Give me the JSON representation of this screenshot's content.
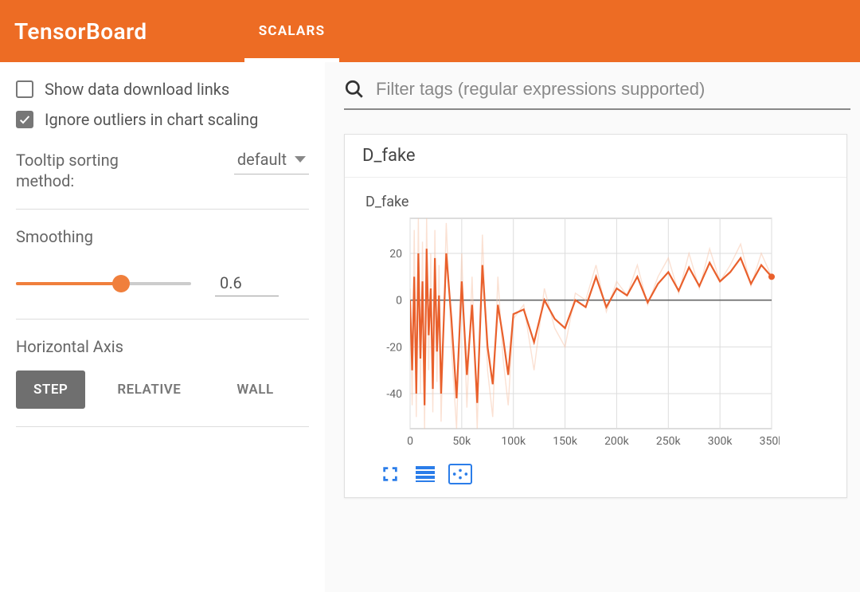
{
  "header": {
    "title": "TensorBoard",
    "tabs": [
      "SCALARS"
    ],
    "active_tab": 0
  },
  "sidebar": {
    "opt_show_download": "Show data download links",
    "opt_ignore_outliers": "Ignore outliers in chart scaling",
    "opt_show_download_checked": false,
    "opt_ignore_outliers_checked": true,
    "tooltip_sort_label": "Tooltip sorting method:",
    "tooltip_sort_value": "default",
    "smoothing_label": "Smoothing",
    "smoothing_value": "0.6",
    "smoothing_fraction": 0.6,
    "horizontal_axis_label": "Horizontal Axis",
    "axis_buttons": [
      "STEP",
      "RELATIVE",
      "WALL"
    ],
    "axis_active": 0
  },
  "main": {
    "search_placeholder": "Filter tags (regular expressions supported)",
    "card_section_title": "D_fake",
    "chart_title": "D_fake"
  },
  "chart_data": {
    "type": "line",
    "title": "D_fake",
    "xlabel": "",
    "ylabel": "",
    "xlim": [
      0,
      350000
    ],
    "ylim": [
      -55,
      35
    ],
    "x_ticks": [
      0,
      50000,
      100000,
      150000,
      200000,
      250000,
      300000,
      350000
    ],
    "x_tick_labels": [
      "0",
      "50k",
      "100k",
      "150k",
      "200k",
      "250k",
      "300k",
      "350k"
    ],
    "y_ticks": [
      -40,
      -20,
      0,
      20
    ],
    "series": [
      {
        "name": "D_fake_raw",
        "smoothed": false,
        "color": "#f7c3a8",
        "x": [
          0,
          2000,
          4000,
          6000,
          8000,
          10000,
          12000,
          14000,
          16000,
          18000,
          20000,
          22000,
          24000,
          26000,
          28000,
          30000,
          35000,
          40000,
          45000,
          50000,
          55000,
          60000,
          65000,
          70000,
          75000,
          80000,
          85000,
          90000,
          95000,
          100000,
          110000,
          120000,
          130000,
          140000,
          150000,
          160000,
          170000,
          180000,
          190000,
          200000,
          210000,
          220000,
          230000,
          240000,
          250000,
          260000,
          270000,
          280000,
          290000,
          300000,
          310000,
          320000,
          330000,
          340000,
          350000
        ],
        "values": [
          5,
          -45,
          30,
          -50,
          35,
          -40,
          25,
          -55,
          35,
          -30,
          20,
          -48,
          30,
          -35,
          15,
          -52,
          33,
          -20,
          -55,
          20,
          -46,
          10,
          -55,
          28,
          -30,
          -50,
          10,
          -25,
          -45,
          -8,
          -2,
          -30,
          5,
          -12,
          -20,
          3,
          0,
          15,
          -5,
          8,
          2,
          15,
          -2,
          10,
          18,
          3,
          20,
          5,
          22,
          8,
          15,
          24,
          6,
          20,
          10
        ]
      },
      {
        "name": "D_fake_smoothed",
        "smoothed": true,
        "color": "#e9602c",
        "x": [
          0,
          2000,
          4000,
          6000,
          8000,
          10000,
          12000,
          14000,
          16000,
          18000,
          20000,
          22000,
          24000,
          26000,
          28000,
          30000,
          35000,
          40000,
          45000,
          50000,
          55000,
          60000,
          65000,
          70000,
          75000,
          80000,
          85000,
          90000,
          95000,
          100000,
          110000,
          120000,
          130000,
          140000,
          150000,
          160000,
          170000,
          180000,
          190000,
          200000,
          210000,
          220000,
          230000,
          240000,
          250000,
          260000,
          270000,
          280000,
          290000,
          300000,
          310000,
          320000,
          330000,
          340000,
          350000
        ],
        "values": [
          0,
          -30,
          10,
          -40,
          20,
          -25,
          8,
          -45,
          22,
          -15,
          5,
          -38,
          18,
          -22,
          2,
          -40,
          20,
          -8,
          -42,
          8,
          -32,
          -2,
          -44,
          15,
          -20,
          -36,
          -2,
          -16,
          -32,
          -6,
          -4,
          -18,
          0,
          -8,
          -12,
          0,
          -3,
          10,
          -3,
          5,
          2,
          10,
          -1,
          7,
          12,
          4,
          14,
          6,
          16,
          8,
          12,
          18,
          7,
          15,
          10
        ]
      }
    ]
  }
}
